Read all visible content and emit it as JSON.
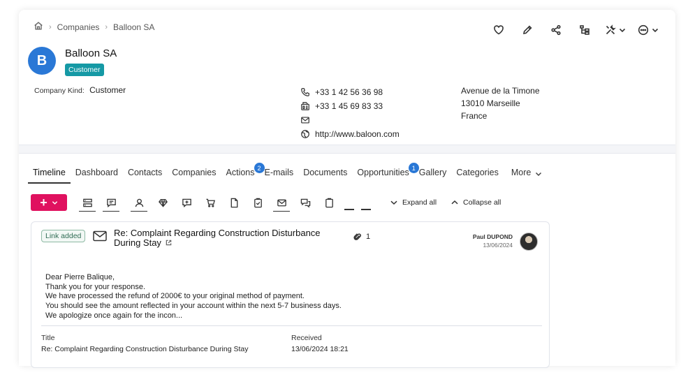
{
  "breadcrumb": {
    "root_icon": "home-icon",
    "items": [
      "Companies",
      "Balloon SA"
    ]
  },
  "header_actions": [
    "heart-icon",
    "pencil-icon",
    "share-icon",
    "hierarchy-icon",
    "tools-icon",
    "more-icon"
  ],
  "company": {
    "initial": "B",
    "name": "Balloon SA",
    "badge": "Customer",
    "kind_label": "Company Kind:",
    "kind_value": "Customer"
  },
  "contact": {
    "phone": "+33 1 42 56 36 98",
    "fax": "+33 1 45 69 83 33",
    "email": "",
    "website": "http://www.baloon.com"
  },
  "address": {
    "line1": "Avenue de la Timone",
    "line2": "13010 Marseille",
    "line3": "France"
  },
  "tabs": [
    {
      "label": "Timeline",
      "active": true
    },
    {
      "label": "Dashboard"
    },
    {
      "label": "Contacts"
    },
    {
      "label": "Companies"
    },
    {
      "label": "Actions",
      "count": "2"
    },
    {
      "label": "E-mails"
    },
    {
      "label": "Documents"
    },
    {
      "label": "Opportunities",
      "count": "1"
    },
    {
      "label": "Gallery"
    },
    {
      "label": "Categories"
    },
    {
      "label": "More"
    }
  ],
  "toolbar": {
    "add_label": "+",
    "expand_all": "Expand all",
    "collapse_all": "Collapse all"
  },
  "email_item": {
    "tag": "Link added",
    "title": "Re: Complaint Regarding Construction Disturbance During Stay",
    "attachments": "1",
    "author": "Paul DUPOND",
    "date": "13/06/2024",
    "body": [
      "Dear Pierre Balique,",
      "Thank you for your response.",
      "We have processed the refund of 2000€ to your original method of payment.",
      "You should see the amount reflected in your account within the next 5-7 business days.",
      "We apologize once again for the incon..."
    ],
    "meta_title_label": "Title",
    "meta_title_value": "Re: Complaint Regarding Construction Disturbance During Stay",
    "meta_received_label": "Received",
    "meta_received_value": "13/06/2024 18:21"
  },
  "colors": {
    "accent_pink": "#e0115f",
    "avatar_blue": "#2a78d6",
    "badge_teal": "#1599a5"
  }
}
